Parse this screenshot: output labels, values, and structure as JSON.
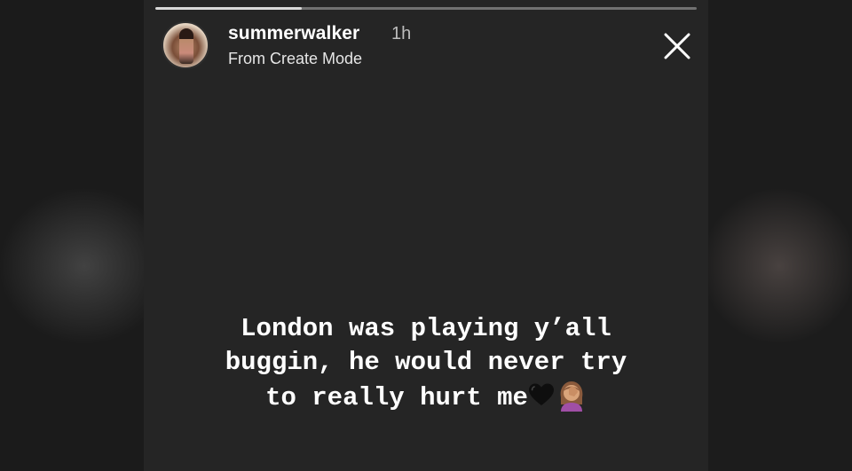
{
  "story": {
    "progress_fraction": 0.27,
    "username": "summerwalker",
    "time_ago": "1h",
    "subtitle": "From Create Mode",
    "caption_lines": [
      "London was playing y’all",
      "buggin, he would never try",
      "to really hurt me"
    ],
    "caption_emojis": [
      "black-heart-icon",
      "facepalm-woman-icon"
    ]
  },
  "colors": {
    "story_background": "#252525",
    "side_background": "#161616",
    "text": "#ffffff"
  }
}
